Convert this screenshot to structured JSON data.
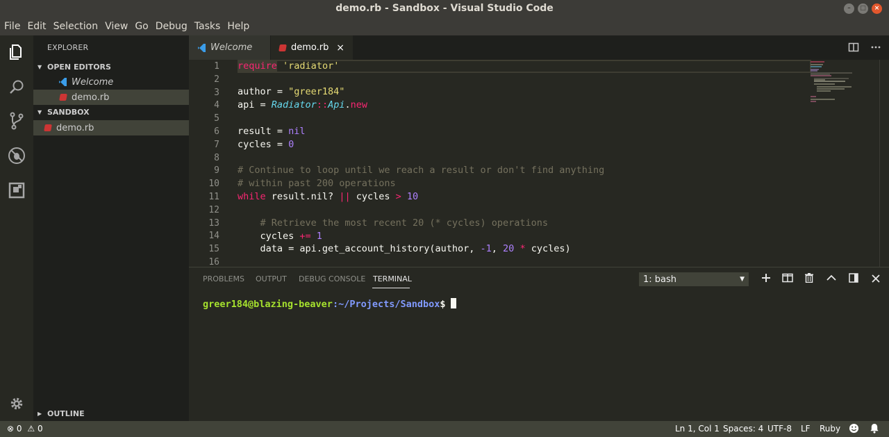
{
  "window": {
    "title": "demo.rb - Sandbox - Visual Studio Code"
  },
  "menu": [
    "File",
    "Edit",
    "Selection",
    "View",
    "Go",
    "Debug",
    "Tasks",
    "Help"
  ],
  "activity_bar": [
    "files-icon",
    "search-icon",
    "source-control-icon",
    "debug-icon",
    "extensions-icon",
    "gear-icon"
  ],
  "sidebar": {
    "title": "EXPLORER",
    "open_editors_label": "OPEN EDITORS",
    "open_editors": [
      "Welcome",
      "demo.rb"
    ],
    "folder_label": "SANDBOX",
    "files": [
      "demo.rb"
    ],
    "outline_label": "OUTLINE"
  },
  "tabs": [
    "Welcome",
    "demo.rb"
  ],
  "editor": {
    "line_numbers": [
      "1",
      "2",
      "3",
      "4",
      "5",
      "6",
      "7",
      "8",
      "9",
      "10",
      "11",
      "12",
      "13",
      "14",
      "15",
      "16"
    ],
    "code": {
      "l1_require": "require",
      "l1_str": "'radiator'",
      "l3_var": "author = ",
      "l3_str": "\"greer184\"",
      "l4_var": "api = ",
      "l4_cls": "Radiator",
      "l4_sep": "::",
      "l4_cls2": "Api",
      "l4_dot": ".",
      "l4_new": "new",
      "l6_var": "result = ",
      "l6_nil": "nil",
      "l7_var": "cycles = ",
      "l7_num": "0",
      "l9_cmt": "# Continue to loop until we reach a result or don't find anything",
      "l10_cmt": "# within past 200 operations",
      "l11_while": "while",
      "l11_mid": " result.nil? ",
      "l11_or": "||",
      "l11_cycles": " cycles ",
      "l11_gt": ">",
      "l11_num": " 10",
      "l13_cmt": "    # Retrieve the most recent 20 (* cycles) operations",
      "l14_var": "    cycles ",
      "l14_op": "+=",
      "l14_num": " 1",
      "l15_a": "    data = api.get_account_history(author, ",
      "l15_n1": "-1",
      "l15_b": ", ",
      "l15_n2": "20",
      "l15_c": " ",
      "l15_op": "*",
      "l15_d": " cycles)"
    }
  },
  "panel": {
    "tabs": [
      "PROBLEMS",
      "OUTPUT",
      "DEBUG CONSOLE",
      "TERMINAL"
    ],
    "terminal_select": "1: bash",
    "prompt_user": "greer184@blazing-beaver",
    "prompt_path": ":~/Projects/Sandbox",
    "prompt_dollar": "$"
  },
  "status": {
    "errors": "0",
    "warnings": "0",
    "position": "Ln 1, Col 1",
    "spaces": "Spaces: 4",
    "encoding": "UTF-8",
    "eol": "LF",
    "language": "Ruby"
  }
}
